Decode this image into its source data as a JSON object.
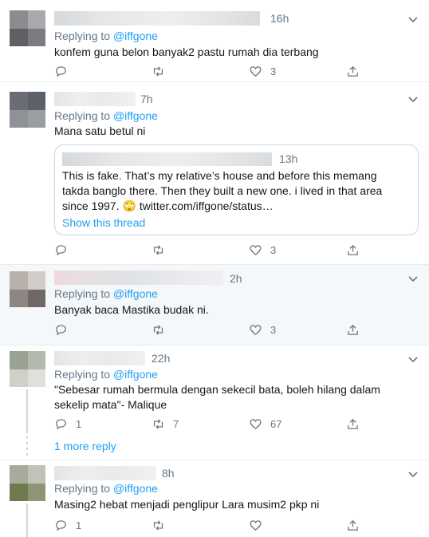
{
  "tweets": [
    {
      "time": "16h",
      "reply_prefix": "Replying to",
      "handle": "@iffgone",
      "text": "konfem guna belon banyak2 pastu rumah dia terbang",
      "replies": "",
      "retweets": "",
      "likes": "3"
    },
    {
      "time": "7h",
      "reply_prefix": "Replying to",
      "handle": "@iffgone",
      "text": "Mana satu betul ni",
      "replies": "",
      "retweets": "",
      "likes": "3",
      "quote": {
        "time": "13h",
        "text": "This is fake. That’s my relative’s house and before this memang takda banglo there. Then they built a new one. i lived in that area since 1997. 🙄 twitter.com/iffgone/status…",
        "show_thread": "Show this thread"
      }
    },
    {
      "time": "2h",
      "reply_prefix": "Replying to",
      "handle": "@iffgone",
      "text": "Banyak baca Mastika budak ni.",
      "replies": "",
      "retweets": "",
      "likes": "3"
    },
    {
      "time": "22h",
      "reply_prefix": "Replying to",
      "handle": "@iffgone",
      "text": "\"Sebesar rumah bermula dengan sekecil bata, boleh hilang dalam sekelip mata\"- Malique",
      "replies": "1",
      "retweets": "7",
      "likes": "67"
    },
    {
      "time": "8h",
      "reply_prefix": "Replying to",
      "handle": "@iffgone",
      "text": "Masing2 hebat menjadi penglipur Lara musim2 pkp ni",
      "replies": "1",
      "retweets": "",
      "likes": ""
    }
  ],
  "more_replies": "1 more reply",
  "icons": {
    "reply": "reply-icon",
    "retweet": "retweet-icon",
    "like": "like-icon",
    "share": "share-icon",
    "caret": "chevron-down-icon"
  },
  "colors": {
    "accent": "#1da1f2",
    "muted": "#657786",
    "border": "#e6ecf0",
    "highlight": "#f5f8fa"
  }
}
